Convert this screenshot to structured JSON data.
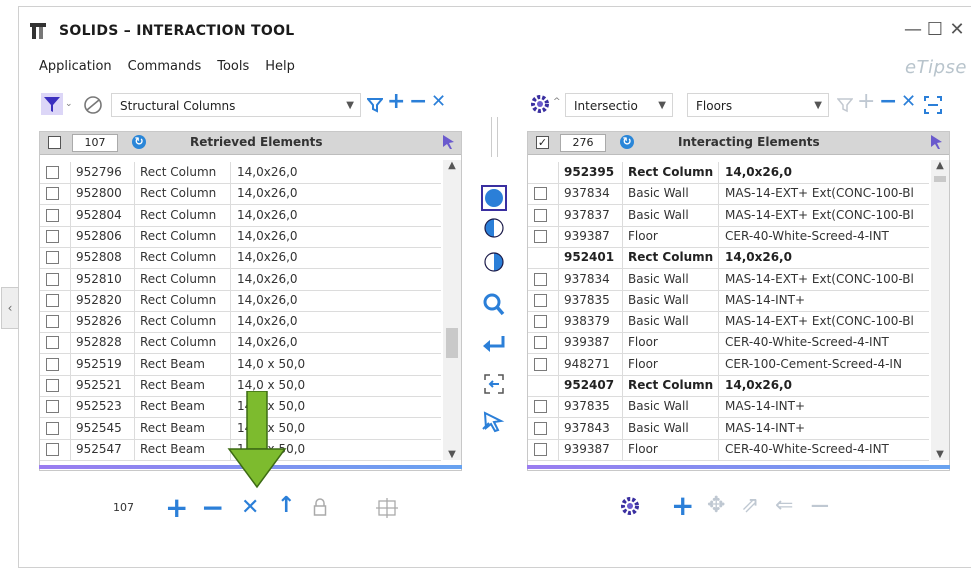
{
  "window": {
    "title": "SOLIDS – INTERACTION TOOL",
    "logo_text": "eTipse"
  },
  "menu": [
    "Application",
    "Commands",
    "Tools",
    "Help"
  ],
  "left": {
    "filter_dropdown": "Structural Columns",
    "header_count": "107",
    "header_title": "Retrieved Elements",
    "rows": [
      {
        "id": "952796",
        "type": "Rect Column",
        "dim": "14,0x26,0"
      },
      {
        "id": "952800",
        "type": "Rect Column",
        "dim": "14,0x26,0"
      },
      {
        "id": "952804",
        "type": "Rect Column",
        "dim": "14,0x26,0"
      },
      {
        "id": "952806",
        "type": "Rect Column",
        "dim": "14,0x26,0"
      },
      {
        "id": "952808",
        "type": "Rect Column",
        "dim": "14,0x26,0"
      },
      {
        "id": "952810",
        "type": "Rect Column",
        "dim": "14,0x26,0"
      },
      {
        "id": "952820",
        "type": "Rect Column",
        "dim": "14,0x26,0"
      },
      {
        "id": "952826",
        "type": "Rect Column",
        "dim": "14,0x26,0"
      },
      {
        "id": "952828",
        "type": "Rect Column",
        "dim": "14,0x26,0"
      },
      {
        "id": "952519",
        "type": "Rect Beam",
        "dim": "14,0 x 50,0"
      },
      {
        "id": "952521",
        "type": "Rect Beam",
        "dim": "14,0 x 50,0"
      },
      {
        "id": "952523",
        "type": "Rect Beam",
        "dim": "14,0 x 50,0"
      },
      {
        "id": "952545",
        "type": "Rect Beam",
        "dim": "14,0 x 50,0"
      },
      {
        "id": "952547",
        "type": "Rect Beam",
        "dim": "14,0 x 50,0"
      }
    ],
    "footer_count": "107"
  },
  "right": {
    "mode_dropdown": "Intersectio",
    "category_dropdown": "Floors",
    "header_count": "276",
    "header_title": "Interacting Elements",
    "rows": [
      {
        "group": true,
        "id": "952395",
        "type": "Rect Column",
        "dim": "14,0x26,0"
      },
      {
        "id": "937834",
        "type": "Basic Wall",
        "dim": "MAS-14-EXT+ Ext(CONC-100-Bl"
      },
      {
        "id": "937837",
        "type": "Basic Wall",
        "dim": "MAS-14-EXT+ Ext(CONC-100-Bl"
      },
      {
        "id": "939387",
        "type": "Floor",
        "dim": "CER-40-White-Screed-4-INT"
      },
      {
        "group": true,
        "id": "952401",
        "type": "Rect Column",
        "dim": "14,0x26,0"
      },
      {
        "id": "937834",
        "type": "Basic Wall",
        "dim": "MAS-14-EXT+ Ext(CONC-100-Bl"
      },
      {
        "id": "937835",
        "type": "Basic Wall",
        "dim": "MAS-14-INT+"
      },
      {
        "id": "938379",
        "type": "Basic Wall",
        "dim": "MAS-14-EXT+ Ext(CONC-100-Bl"
      },
      {
        "id": "939387",
        "type": "Floor",
        "dim": "CER-40-White-Screed-4-INT"
      },
      {
        "id": "948271",
        "type": "Floor",
        "dim": "CER-100-Cement-Screed-4-IN"
      },
      {
        "group": true,
        "id": "952407",
        "type": "Rect Column",
        "dim": "14,0x26,0"
      },
      {
        "id": "937835",
        "type": "Basic Wall",
        "dim": "MAS-14-INT+"
      },
      {
        "id": "937843",
        "type": "Basic Wall",
        "dim": "MAS-14-INT+"
      },
      {
        "id": "939387",
        "type": "Floor",
        "dim": "CER-40-White-Screed-4-INT"
      }
    ]
  },
  "colors": {
    "accent_blue": "#2b7fd8",
    "arrow_green": "#7dbb2e",
    "header_grey": "#d6d6d6"
  },
  "icons": [
    "app-logo-icon",
    "filter-icon",
    "no-entry-icon",
    "gear-icon",
    "refresh-icon",
    "pointer-icon",
    "sphere-icon",
    "half-circle-icon",
    "zoom-icon",
    "return-arrow-icon",
    "select-frame-icon",
    "wand-icon",
    "lock-icon",
    "grid-icon",
    "plus-icon",
    "minus-icon",
    "close-icon",
    "up-arrow-icon"
  ]
}
